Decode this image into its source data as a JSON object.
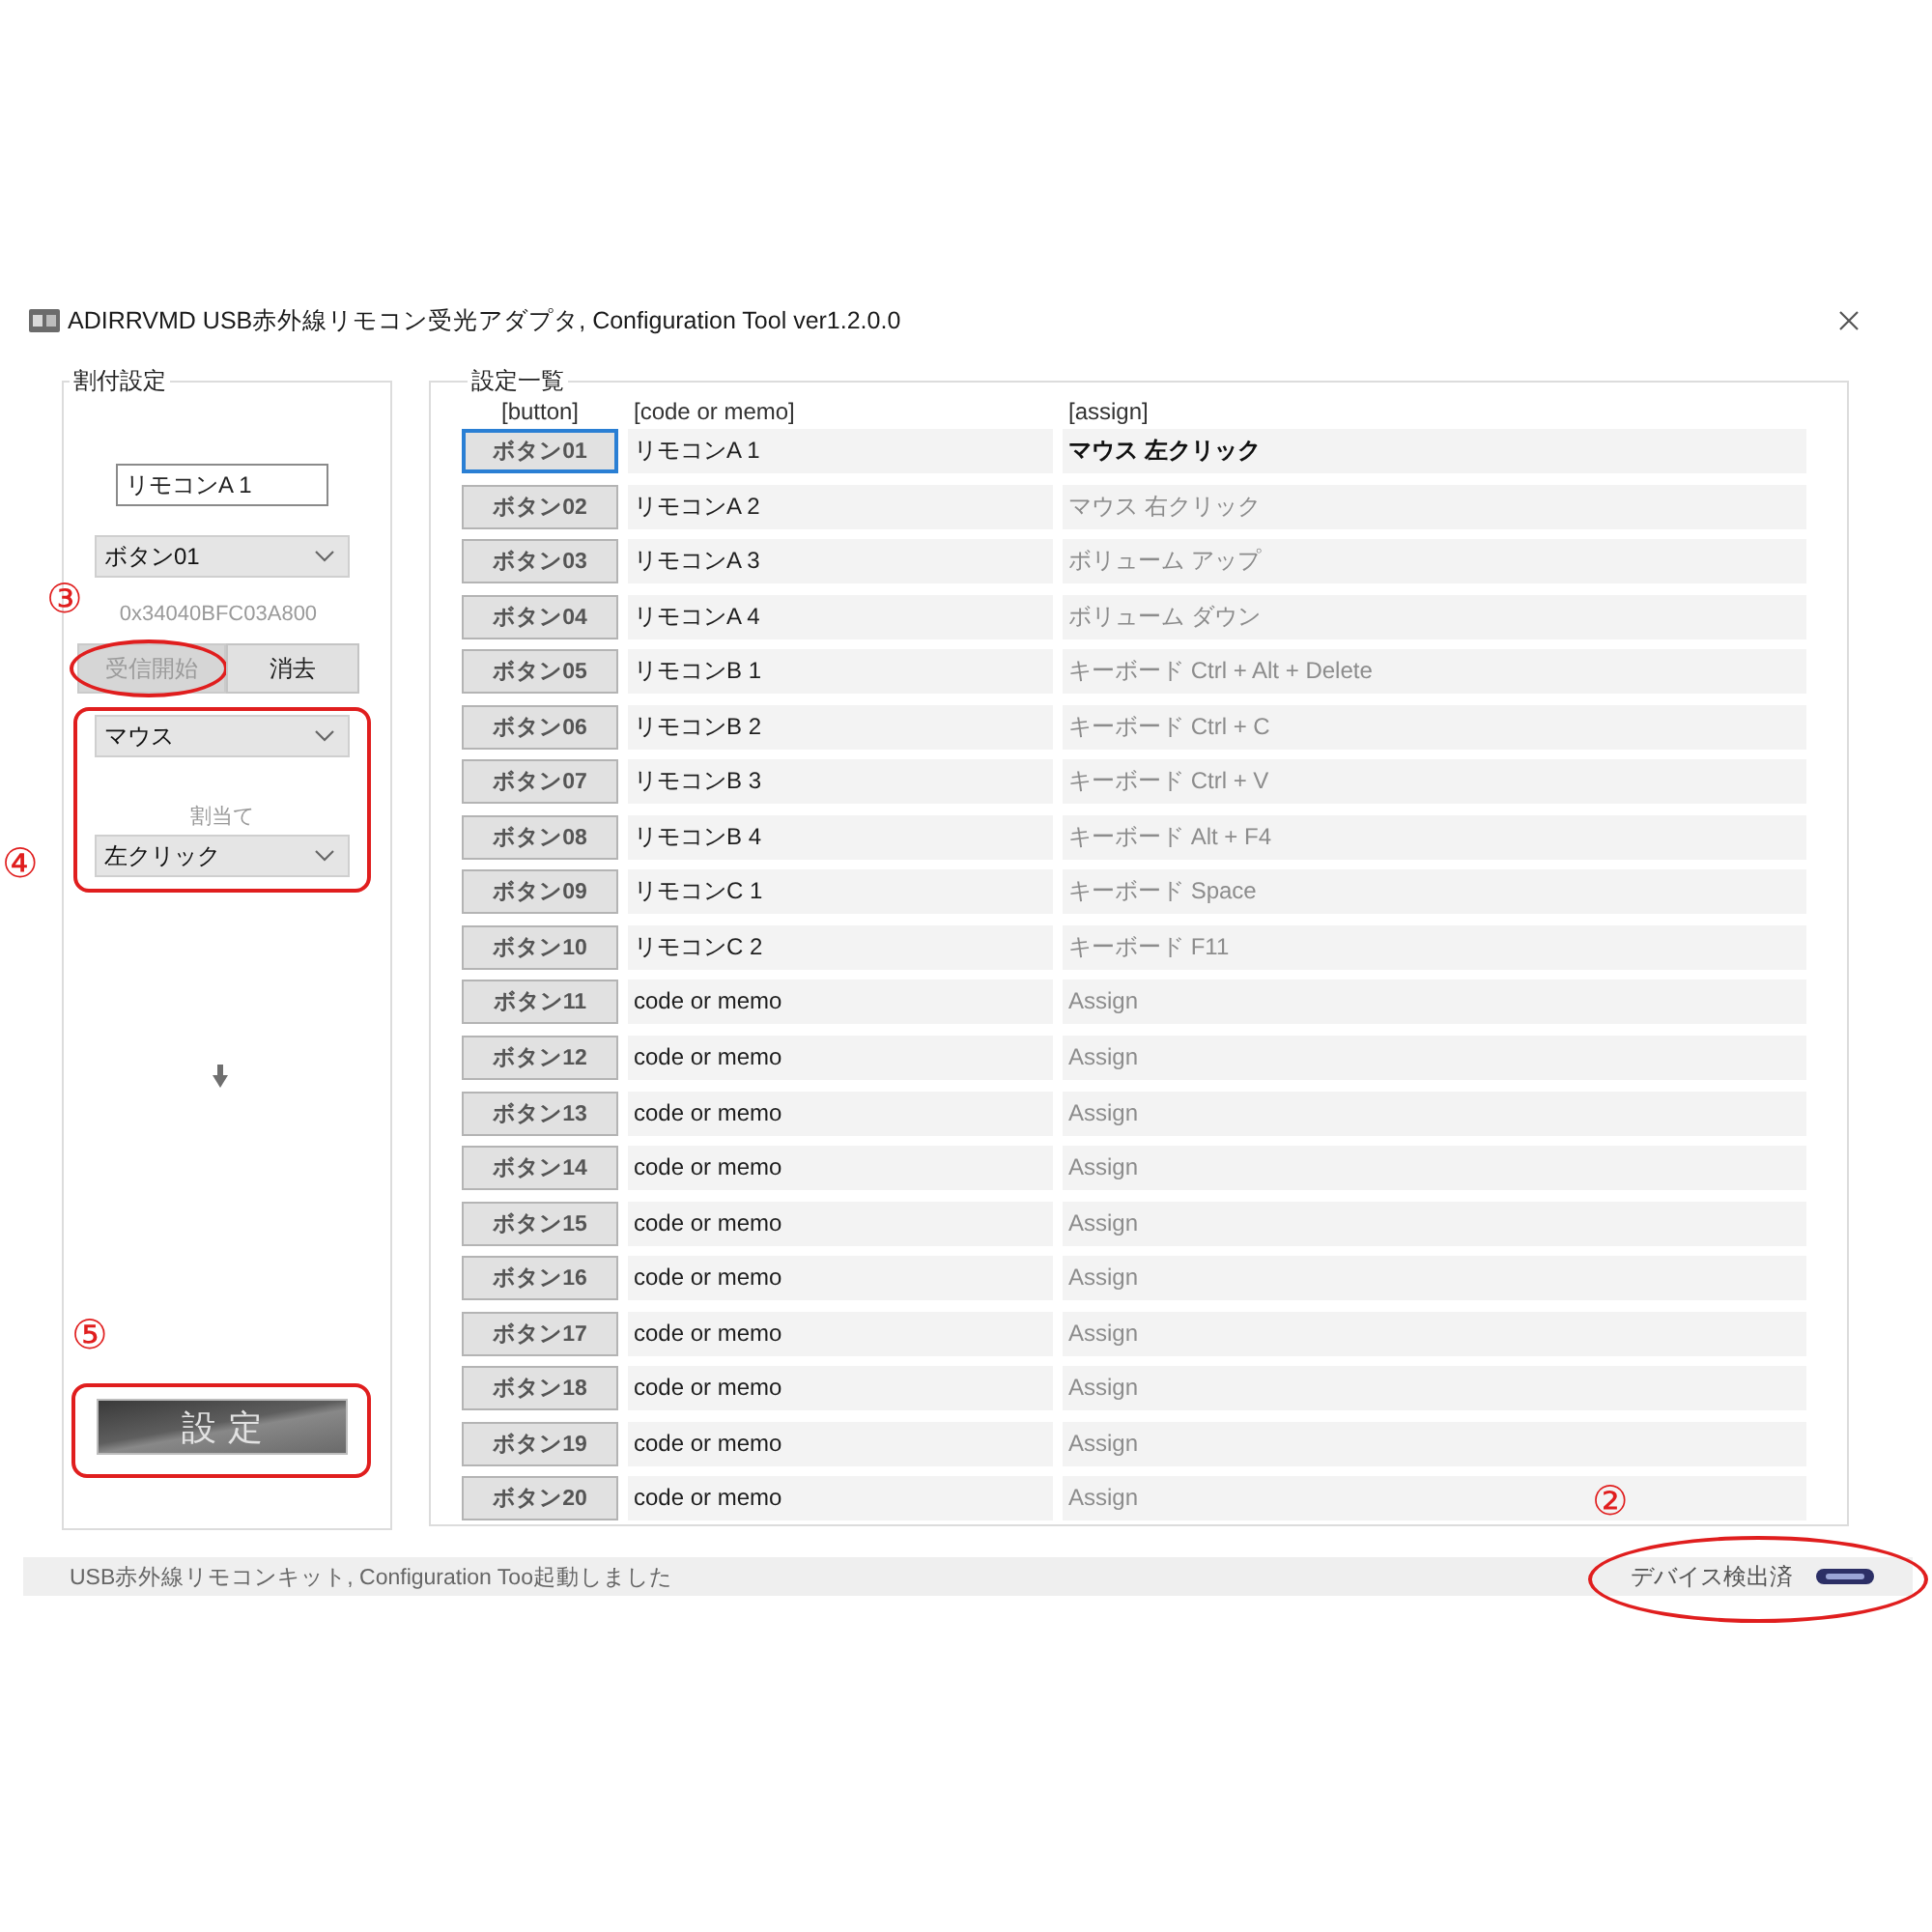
{
  "window": {
    "title": "ADIRRVMD USB赤外線リモコン受光アダプタ, Configuration Tool ver1.2.0.0"
  },
  "assignment_panel": {
    "title": "割付設定",
    "name_field": {
      "value": "リモコンA 1"
    },
    "button_select": {
      "value": "ボタン01"
    },
    "code": "0x34040BFC03A800",
    "actions": [
      {
        "label": "受信開始",
        "disabled": true,
        "callout": {
          "number": "③",
          "kind": "ellipse"
        }
      },
      {
        "label": "消去",
        "disabled": false
      }
    ],
    "assign_group": {
      "category_select": {
        "value": "マウス"
      },
      "label": "割当て",
      "action_select": {
        "value": "左クリック"
      },
      "callout": {
        "number": "④",
        "kind": "frame"
      }
    },
    "apply_button": {
      "label": "設定",
      "callout": {
        "number": "⑤",
        "kind": "frame"
      }
    }
  },
  "settings_list": {
    "title": "設定一覧",
    "columns": [
      "[button]",
      "[code or memo]",
      "[assign]"
    ],
    "rows": [
      {
        "button": "ボタン01",
        "code": "リモコンA 1",
        "assign": "マウス 左クリック",
        "selected": true
      },
      {
        "button": "ボタン02",
        "code": "リモコンA 2",
        "assign": "マウス 右クリック",
        "selected": false
      },
      {
        "button": "ボタン03",
        "code": "リモコンA 3",
        "assign": "ボリューム アップ",
        "selected": false
      },
      {
        "button": "ボタン04",
        "code": "リモコンA 4",
        "assign": "ボリューム ダウン",
        "selected": false
      },
      {
        "button": "ボタン05",
        "code": "リモコンB 1",
        "assign": "キーボード Ctrl + Alt + Delete",
        "selected": false
      },
      {
        "button": "ボタン06",
        "code": "リモコンB 2",
        "assign": "キーボード Ctrl + C",
        "selected": false
      },
      {
        "button": "ボタン07",
        "code": "リモコンB 3",
        "assign": "キーボード Ctrl + V",
        "selected": false
      },
      {
        "button": "ボタン08",
        "code": "リモコンB 4",
        "assign": "キーボード Alt + F4",
        "selected": false
      },
      {
        "button": "ボタン09",
        "code": "リモコンC 1",
        "assign": "キーボード Space",
        "selected": false
      },
      {
        "button": "ボタン10",
        "code": "リモコンC 2",
        "assign": "キーボード F11",
        "selected": false
      },
      {
        "button": "ボタン11",
        "code": "code or memo",
        "assign": "Assign",
        "selected": false
      },
      {
        "button": "ボタン12",
        "code": "code or memo",
        "assign": "Assign",
        "selected": false
      },
      {
        "button": "ボタン13",
        "code": "code or memo",
        "assign": "Assign",
        "selected": false
      },
      {
        "button": "ボタン14",
        "code": "code or memo",
        "assign": "Assign",
        "selected": false
      },
      {
        "button": "ボタン15",
        "code": "code or memo",
        "assign": "Assign",
        "selected": false
      },
      {
        "button": "ボタン16",
        "code": "code or memo",
        "assign": "Assign",
        "selected": false
      },
      {
        "button": "ボタン17",
        "code": "code or memo",
        "assign": "Assign",
        "selected": false
      },
      {
        "button": "ボタン18",
        "code": "code or memo",
        "assign": "Assign",
        "selected": false
      },
      {
        "button": "ボタン19",
        "code": "code or memo",
        "assign": "Assign",
        "selected": false
      },
      {
        "button": "ボタン20",
        "code": "code or memo",
        "assign": "Assign",
        "selected": false
      }
    ]
  },
  "status_bar": {
    "message": "USB赤外線リモコンキット, Configuration Too起動しました",
    "device_status": "デバイス検出済",
    "callout": {
      "number": "②",
      "kind": "ellipse"
    }
  }
}
